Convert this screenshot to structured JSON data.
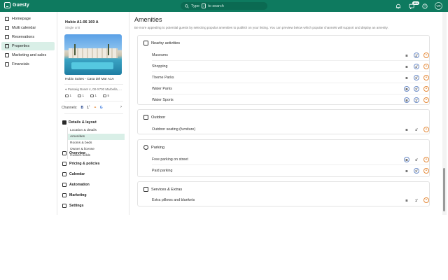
{
  "app": {
    "name": "Guesty",
    "brand_color": "#0e7a5f"
  },
  "topbar": {
    "search_placeholder": "Type",
    "search_key": "/",
    "search_suffix": "to search",
    "notification_badge": "99+",
    "avatar_initials": "VR",
    "icons": [
      "bell-icon",
      "chat-icon",
      "help-icon"
    ]
  },
  "sidenav": {
    "items": [
      {
        "label": "Homepage",
        "icon": "home-icon",
        "active": false
      },
      {
        "label": "Multi calendar",
        "icon": "calendar-icon",
        "active": false
      },
      {
        "label": "Reservations",
        "icon": "reservations-icon",
        "active": false
      },
      {
        "label": "Properties",
        "icon": "properties-icon",
        "active": true
      },
      {
        "label": "Marketing and sales",
        "icon": "marketing-icon",
        "active": false
      },
      {
        "label": "Financials",
        "icon": "financials-icon",
        "active": false
      }
    ]
  },
  "property": {
    "title": "Hubix A1-06 169 A",
    "subtitle": "Single unit",
    "name": "Hubix Suites - Casa del Mar A1A",
    "address": "Passeig Bonet 4, 00-X700 Marbella, ...",
    "stats": [
      "1",
      "1",
      "1",
      "5"
    ],
    "channels_label": "Channels:",
    "channels": [
      "B",
      "1˚",
      "⚭",
      "G"
    ]
  },
  "panel": {
    "section": "Details & layout",
    "subitems": [
      {
        "label": "Location & details",
        "active": false
      },
      {
        "label": "Amenities",
        "active": true
      },
      {
        "label": "Rooms & beds",
        "active": false
      },
      {
        "label": "Owner & license",
        "active": false
      },
      {
        "label": "Custom fields",
        "active": false
      }
    ],
    "items": [
      {
        "label": "Overview",
        "icon": "overview-icon"
      },
      {
        "label": "Pricing & policies",
        "icon": "pricing-icon"
      },
      {
        "label": "Calendar",
        "icon": "calendar-icon"
      },
      {
        "label": "Automation",
        "icon": "automation-icon"
      },
      {
        "label": "Marketing",
        "icon": "marketing-icon"
      },
      {
        "label": "Settings",
        "icon": "settings-icon"
      }
    ]
  },
  "main": {
    "title": "Amenities",
    "description": "Be more appealing to potential guests by selecting popular amenities to publish on your listing. You can preview below which popular channels will support and display an amenity.",
    "categories": [
      {
        "title": "Nearby activities",
        "icon": "activities-icon",
        "rows": [
          {
            "label": "Museums",
            "b_ring": false
          },
          {
            "label": "Shopping",
            "b_ring": false
          },
          {
            "label": "Theme Parks",
            "b_ring": false
          },
          {
            "label": "Water Parks",
            "b_ring": true
          },
          {
            "label": "Water Sports",
            "b_ring": true
          }
        ]
      },
      {
        "title": "Outdoor",
        "icon": "outdoor-icon",
        "rows": [
          {
            "label": "Outdoor seating (furniture)",
            "b_ring": false
          }
        ]
      },
      {
        "title": "Parking",
        "icon": "parking-icon",
        "rows": [
          {
            "label": "Free parking on street",
            "b_ring": true
          },
          {
            "label": "Paid parking",
            "b_ring": false
          }
        ]
      },
      {
        "title": "Services & Extras",
        "icon": "services-icon",
        "rows": [
          {
            "label": "Extra pillows and blankets",
            "b_ring": false
          }
        ]
      }
    ],
    "channel_glyphs": {
      "booking": "B",
      "vrbo": "1˚",
      "airbnb": "⚭"
    }
  }
}
